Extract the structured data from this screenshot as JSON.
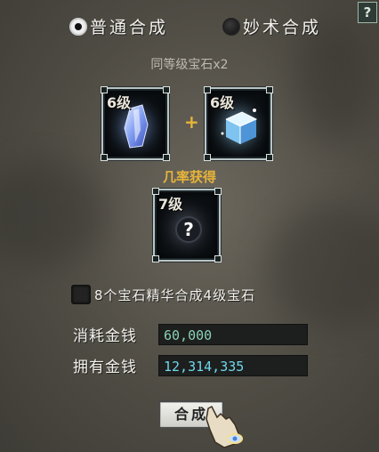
{
  "help_button": "?",
  "mode": {
    "options": [
      {
        "label": "普通合成",
        "selected": true
      },
      {
        "label": "妙术合成",
        "selected": false
      }
    ]
  },
  "requirement": "同等级宝石x2",
  "inputs": [
    {
      "level": "6级"
    },
    {
      "level": "6级"
    }
  ],
  "plus": "+",
  "chance": "几率获得",
  "output": {
    "level": "7级"
  },
  "checkbox_label": "8个宝石精华合成4级宝石",
  "money": {
    "cost_label": "消耗金钱",
    "cost_value": "60,000",
    "have_label": "拥有金钱",
    "have_value": "12,314,335"
  },
  "synth_button": "合成",
  "colors": {
    "gold": "#e6b43a",
    "cost": "#8ad0b4",
    "have": "#6fd7ec"
  }
}
